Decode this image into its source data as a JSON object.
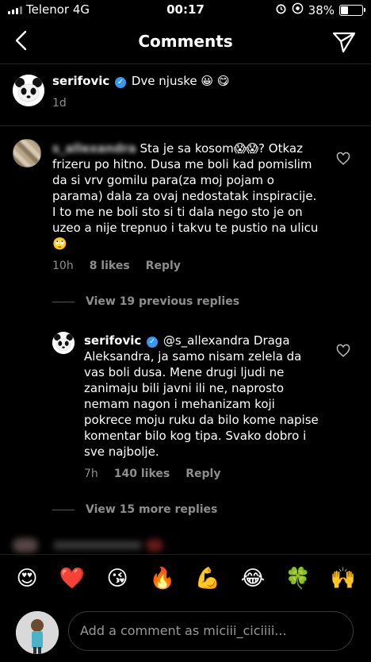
{
  "status_bar": {
    "carrier": "Telenor 4G",
    "time": "00:17",
    "battery_percent": "38%",
    "battery_level": 0.38
  },
  "header": {
    "title": "Comments"
  },
  "caption": {
    "username": "serifovic",
    "text": "Dve njuske 😀 😋",
    "time": "1d"
  },
  "comment": {
    "username": "s_allexandra",
    "text_line1": "Sta je sa kosom😱😱?",
    "text_rest": "Otkaz frizeru po hitno. Dusa me boli kad pomislim da si vrv gomilu para(za moj pojam o parama) dala za ovaj nedostatak inspiracije. I to me ne boli sto si ti dala nego sto je on uzeo a nije trepnuo i takvu te pustio na ulicu🙄",
    "time": "10h",
    "likes": "8 likes",
    "reply": "Reply"
  },
  "view_previous": "View 19 previous replies",
  "reply_comment": {
    "username": "serifovic",
    "text": "@s_allexandra Draga Aleksandra, ja samo nisam zelela da vas boli dusa. Mene drugi ljudi ne zanimaju bili javni ili ne, naprosto nemam nagon i mehanizam koji pokrece moju ruku da bilo kome napise komentar bilo kog tipa. Svako dobro i sve najbolje.",
    "time": "7h",
    "likes": "140 likes",
    "reply": "Reply"
  },
  "view_more": "View 15 more replies",
  "reactions": [
    "😍",
    "❤️",
    "😘",
    "🔥",
    "💪",
    "😂",
    "🍀",
    "🙌"
  ],
  "composer": {
    "placeholder": "Add a comment as miciii_ciciiii..."
  },
  "icons": [
    "chevron-left-icon",
    "send-icon",
    "heart-icon",
    "verified-icon",
    "alarm-icon",
    "at-icon"
  ]
}
